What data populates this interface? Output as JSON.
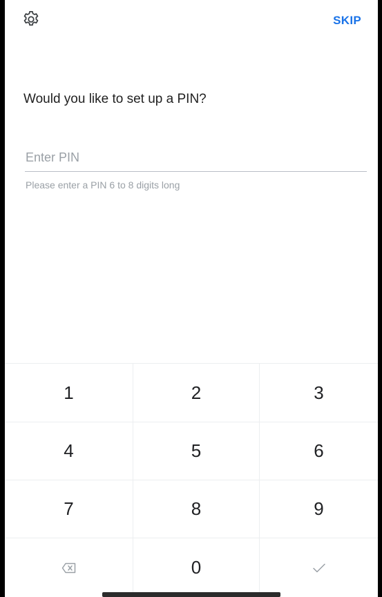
{
  "header": {
    "settings_icon": "gear-icon",
    "skip_label": "SKIP"
  },
  "prompt": {
    "title": "Would you like to set up a PIN?",
    "input_value": "",
    "input_placeholder": "Enter PIN",
    "hint": "Please enter a PIN 6 to 8 digits long"
  },
  "keypad": {
    "keys": [
      "1",
      "2",
      "3",
      "4",
      "5",
      "6",
      "7",
      "8",
      "9",
      "",
      "0",
      ""
    ],
    "delete_icon": "backspace-icon",
    "confirm_icon": "checkmark-icon"
  },
  "colors": {
    "accent": "#1a73e8",
    "text": "#1f1f1f",
    "muted": "#9aa0a6",
    "divider": "#eceef0"
  }
}
